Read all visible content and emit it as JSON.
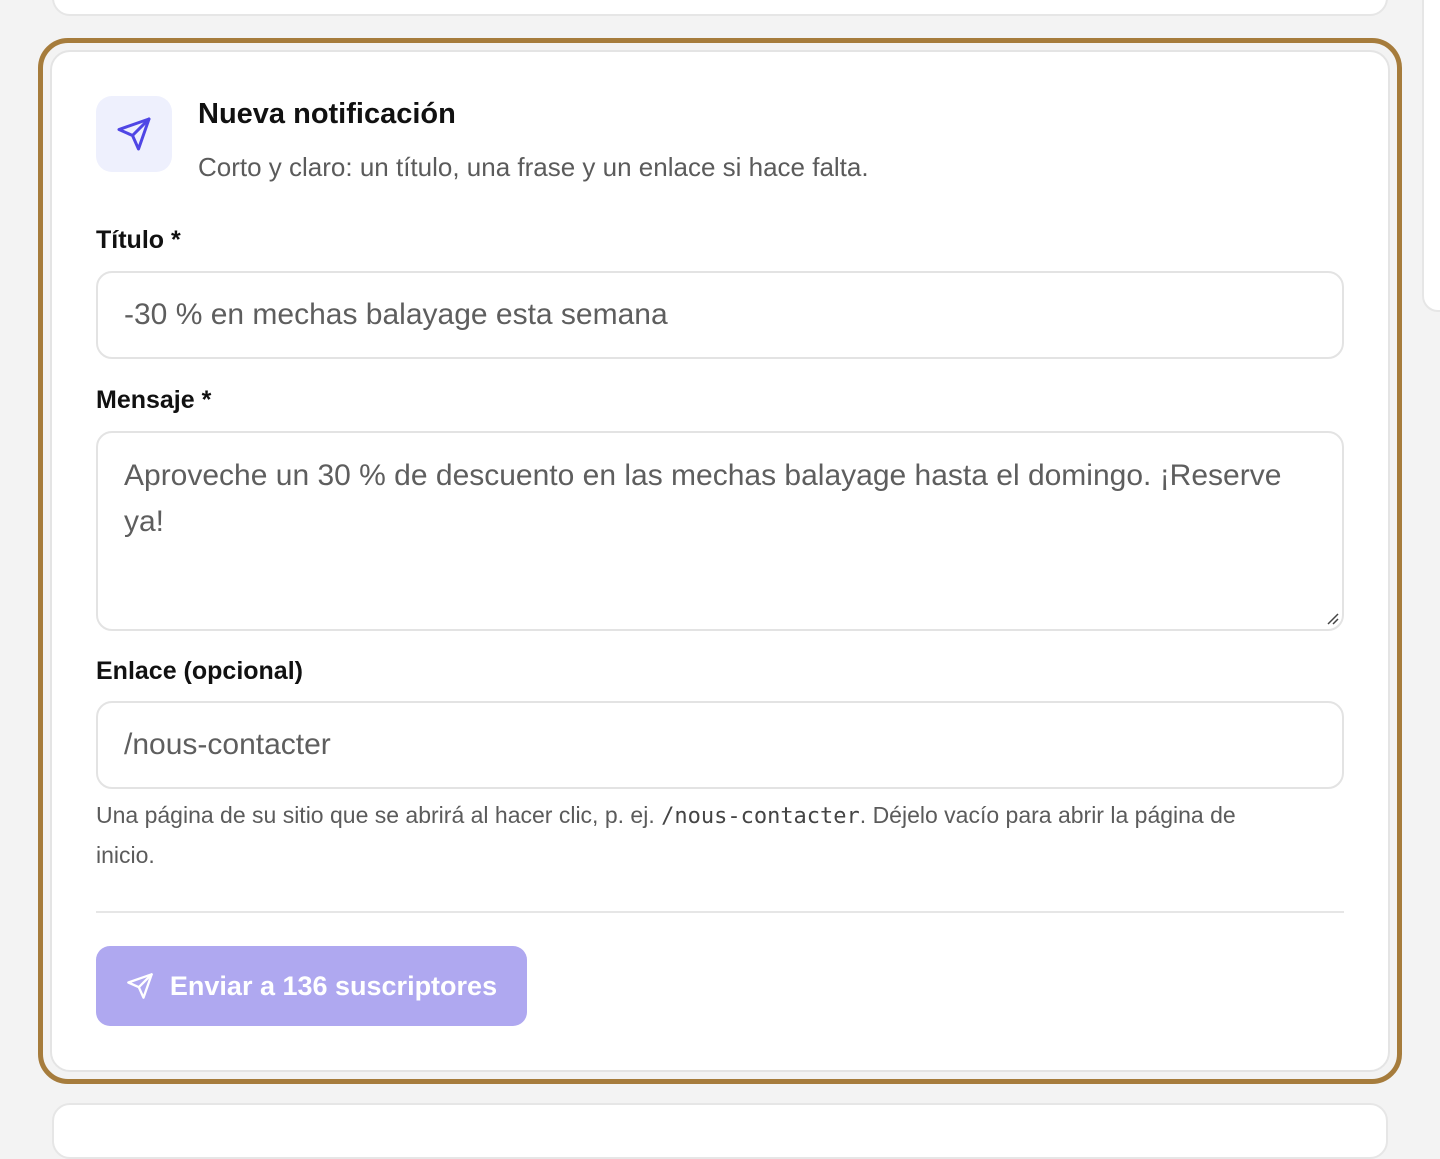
{
  "header": {
    "icon": "send-icon",
    "title": "Nueva notificación",
    "subtitle": "Corto y claro: un título, una frase y un enlace si hace falta."
  },
  "form": {
    "title_label": "Título *",
    "title_value": "-30 % en mechas balayage esta semana",
    "message_label": "Mensaje *",
    "message_value": "Aproveche un 30 % de descuento en las mechas balayage hasta el domingo. ¡Reserve ya!",
    "link_label": "Enlace (opcional)",
    "link_value": "/nous-contacter",
    "link_hint": {
      "before": "Una página de su sitio que se abrirá al hacer clic, p. ej. ",
      "code": "/nous-contacter",
      "after": ". Déjelo vacío para abrir la página de inicio."
    }
  },
  "send_button": {
    "icon": "send-icon",
    "label": "Enviar a 136 suscriptores"
  },
  "colors": {
    "highlight_border": "#a67c3c",
    "accent_icon": "#4f46e5",
    "button_bg": "#afa8f0",
    "icon_tile_bg": "#eef0fd"
  }
}
